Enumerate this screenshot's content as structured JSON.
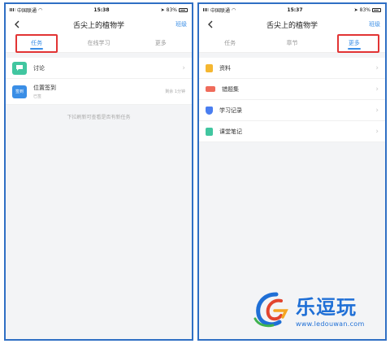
{
  "left": {
    "status": {
      "carrier": "中国联通",
      "time": "15:38",
      "battery": "83%"
    },
    "nav": {
      "title": "舌尖上的植物学",
      "action": "班级"
    },
    "tabs": [
      {
        "label": "任务",
        "active": true
      },
      {
        "label": "在线学习",
        "active": false
      },
      {
        "label": "更多",
        "active": false
      }
    ],
    "tasks": [
      {
        "icon": "discussion-icon",
        "color": "#41c6a0",
        "label": "讨论",
        "sub": "",
        "meta": ""
      },
      {
        "icon": "sign-in-icon",
        "icon_text": "签到",
        "color": "#3a8ee6",
        "label": "位置签到",
        "sub": "已签",
        "meta": "剩余 1分钟"
      }
    ],
    "empty_hint": "下拉刷新可查看是否有新任务"
  },
  "right": {
    "status": {
      "carrier": "中国联通",
      "time": "15:37",
      "battery": "83%"
    },
    "nav": {
      "title": "舌尖上的植物学",
      "action": "班级"
    },
    "tabs": [
      {
        "label": "任务",
        "active": false
      },
      {
        "label": "章节",
        "active": false
      },
      {
        "label": "更多",
        "active": true
      }
    ],
    "items": [
      {
        "icon": "document-icon",
        "color": "#f5b731",
        "label": "资料"
      },
      {
        "icon": "wrong-answers-icon",
        "color": "#ef6b5b",
        "label": "错题集"
      },
      {
        "icon": "learning-record-icon",
        "color": "#4a7ef0",
        "label": "学习记录"
      },
      {
        "icon": "notes-icon",
        "color": "#41c6a0",
        "label": "课堂笔记"
      }
    ]
  },
  "watermark": {
    "brand": "乐逗玩",
    "url": "www.ledouwan.com"
  },
  "colors": {
    "accent": "#3a8ee6",
    "highlight": "#e23434",
    "frame": "#2f6fc4"
  }
}
